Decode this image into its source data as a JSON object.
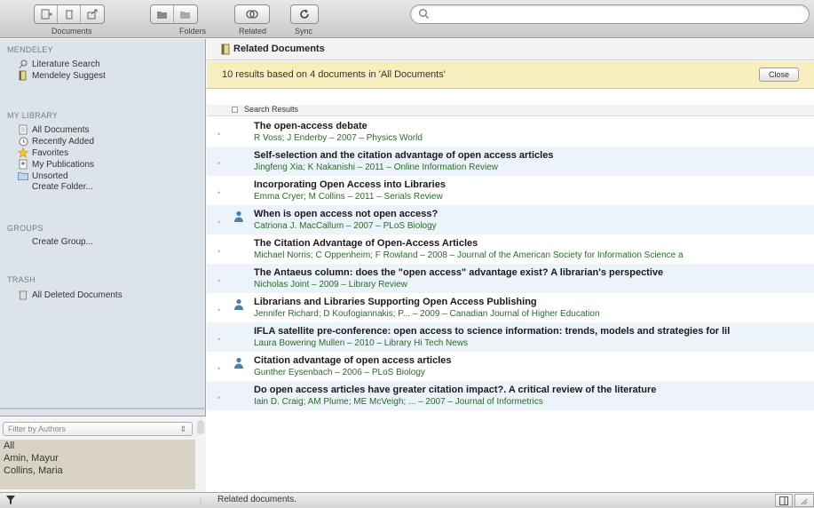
{
  "toolbar": {
    "labels": {
      "documents": "Documents",
      "folders": "Folders",
      "related": "Related",
      "sync": "Sync"
    },
    "search": {
      "placeholder": "",
      "value": ""
    }
  },
  "sidebar": {
    "mendeley_header": "MENDELEY",
    "literature_search": "Literature Search",
    "mendeley_suggest": "Mendeley Suggest",
    "my_library_header": "MY LIBRARY",
    "all_documents": "All Documents",
    "recently_added": "Recently Added",
    "favorites": "Favorites",
    "my_publications": "My Publications",
    "unsorted": "Unsorted",
    "create_folder": "Create Folder...",
    "groups_header": "GROUPS",
    "create_group": "Create Group...",
    "trash_header": "TRASH",
    "all_deleted": "All Deleted Documents"
  },
  "filter": {
    "selected": "Filter by Authors",
    "authors": [
      "All",
      "Amin, Mayur",
      "Collins, Maria",
      ""
    ]
  },
  "panel": {
    "title": "Related Documents",
    "banner": "10 results based on 4 documents in 'All Documents'",
    "close_label": "Close",
    "column": "Search Results"
  },
  "results": [
    {
      "title": "The open-access debate",
      "meta": "R Voss; J Enderby – 2007 – Physics World",
      "has_person": false
    },
    {
      "title": "Self-selection and the citation advantage of open access articles",
      "meta": "Jingfeng Xia; K Nakanishi – 2011 – Online Information Review",
      "has_person": false
    },
    {
      "title": "Incorporating Open Access into Libraries",
      "meta": "Emma Cryer; M Collins – 2011 – Serials Review",
      "has_person": false
    },
    {
      "title": "When is open access not open access?",
      "meta": "Catriona J. MacCallum – 2007 – PLoS Biology",
      "has_person": true
    },
    {
      "title": "The Citation Advantage of Open-Access Articles",
      "meta": "Michael Norris; C Oppenheim; F Rowland – 2008 – Journal of the American Society for Information Science a",
      "has_person": false
    },
    {
      "title": "The Antaeus column: does the \"open access\" advantage exist? A librarian's perspective",
      "meta": "Nicholas Joint – 2009 – Library Review",
      "has_person": false
    },
    {
      "title": "Librarians and Libraries Supporting Open Access Publishing",
      "meta": "Jennifer Richard; D Koufogiannakis; P... – 2009 – Canadian Journal of Higher Education",
      "has_person": true
    },
    {
      "title": "IFLA satellite pre-conference: open access to science information: trends, models and strategies for lil",
      "meta": "Laura Bowering Mullen – 2010 – Library Hi Tech News",
      "has_person": false
    },
    {
      "title": "Citation advantage of open access articles",
      "meta": "Gunther Eysenbach – 2006 – PLoS Biology",
      "has_person": true
    },
    {
      "title": "Do open access articles have greater citation impact?. A critical review of the literature",
      "meta": "Iain D. Craig; AM Plume; ME McVeigh; ... – 2007 – Journal of Informetrics",
      "has_person": false
    }
  ],
  "status": {
    "text": "Related documents."
  }
}
